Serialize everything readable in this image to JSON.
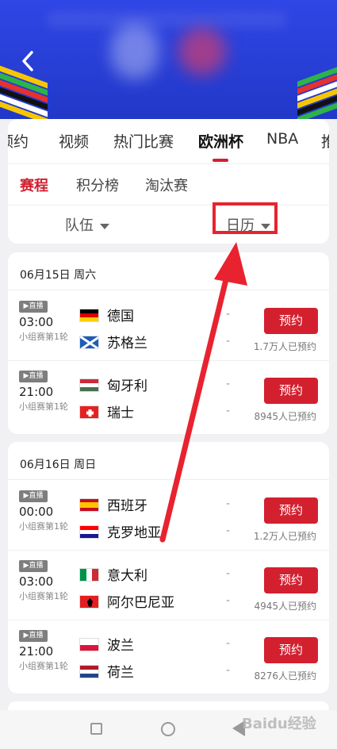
{
  "header": {
    "back_icon": "chevron-left-icon"
  },
  "tabs": [
    {
      "label": "预约",
      "active": false
    },
    {
      "label": "视频",
      "active": false
    },
    {
      "label": "热门比赛",
      "active": false
    },
    {
      "label": "欧洲杯",
      "active": true
    },
    {
      "label": "NBA",
      "active": false
    },
    {
      "label": "推",
      "active": false
    }
  ],
  "subtabs": [
    {
      "label": "赛程",
      "active": true
    },
    {
      "label": "积分榜",
      "active": false
    },
    {
      "label": "淘汰赛",
      "active": false
    }
  ],
  "filters": {
    "team": "队伍",
    "calendar": "日历"
  },
  "days": [
    {
      "date": "06月15日 周六",
      "matches": [
        {
          "badge": "▶直播",
          "time": "03:00",
          "stage": "小组赛第1轮",
          "team1": "德国",
          "team2": "苏格兰",
          "score1": "-",
          "score2": "-",
          "button": "预约",
          "reserved": "1.7万人已预约",
          "flag1": "germany",
          "flag2": "scotland"
        },
        {
          "badge": "▶直播",
          "time": "21:00",
          "stage": "小组赛第1轮",
          "team1": "匈牙利",
          "team2": "瑞士",
          "score1": "-",
          "score2": "-",
          "button": "预约",
          "reserved": "8945人已预约",
          "flag1": "hungary",
          "flag2": "switzerland"
        }
      ]
    },
    {
      "date": "06月16日 周日",
      "matches": [
        {
          "badge": "▶直播",
          "time": "00:00",
          "stage": "小组赛第1轮",
          "team1": "西班牙",
          "team2": "克罗地亚",
          "score1": "-",
          "score2": "-",
          "button": "预约",
          "reserved": "1.2万人已预约",
          "flag1": "spain",
          "flag2": "croatia"
        },
        {
          "badge": "▶直播",
          "time": "03:00",
          "stage": "小组赛第1轮",
          "team1": "意大利",
          "team2": "阿尔巴尼亚",
          "score1": "-",
          "score2": "-",
          "button": "预约",
          "reserved": "4945人已预约",
          "flag1": "italy",
          "flag2": "albania"
        },
        {
          "badge": "▶直播",
          "time": "21:00",
          "stage": "小组赛第1轮",
          "team1": "波兰",
          "team2": "荷兰",
          "score1": "-",
          "score2": "-",
          "button": "预约",
          "reserved": "8276人已预约",
          "flag1": "poland",
          "flag2": "netherlands"
        }
      ]
    }
  ],
  "watermark": "Baidu经验",
  "colors": {
    "accent": "#d3202f",
    "banner": "#2f46e6",
    "annotation": "#e8232f"
  }
}
